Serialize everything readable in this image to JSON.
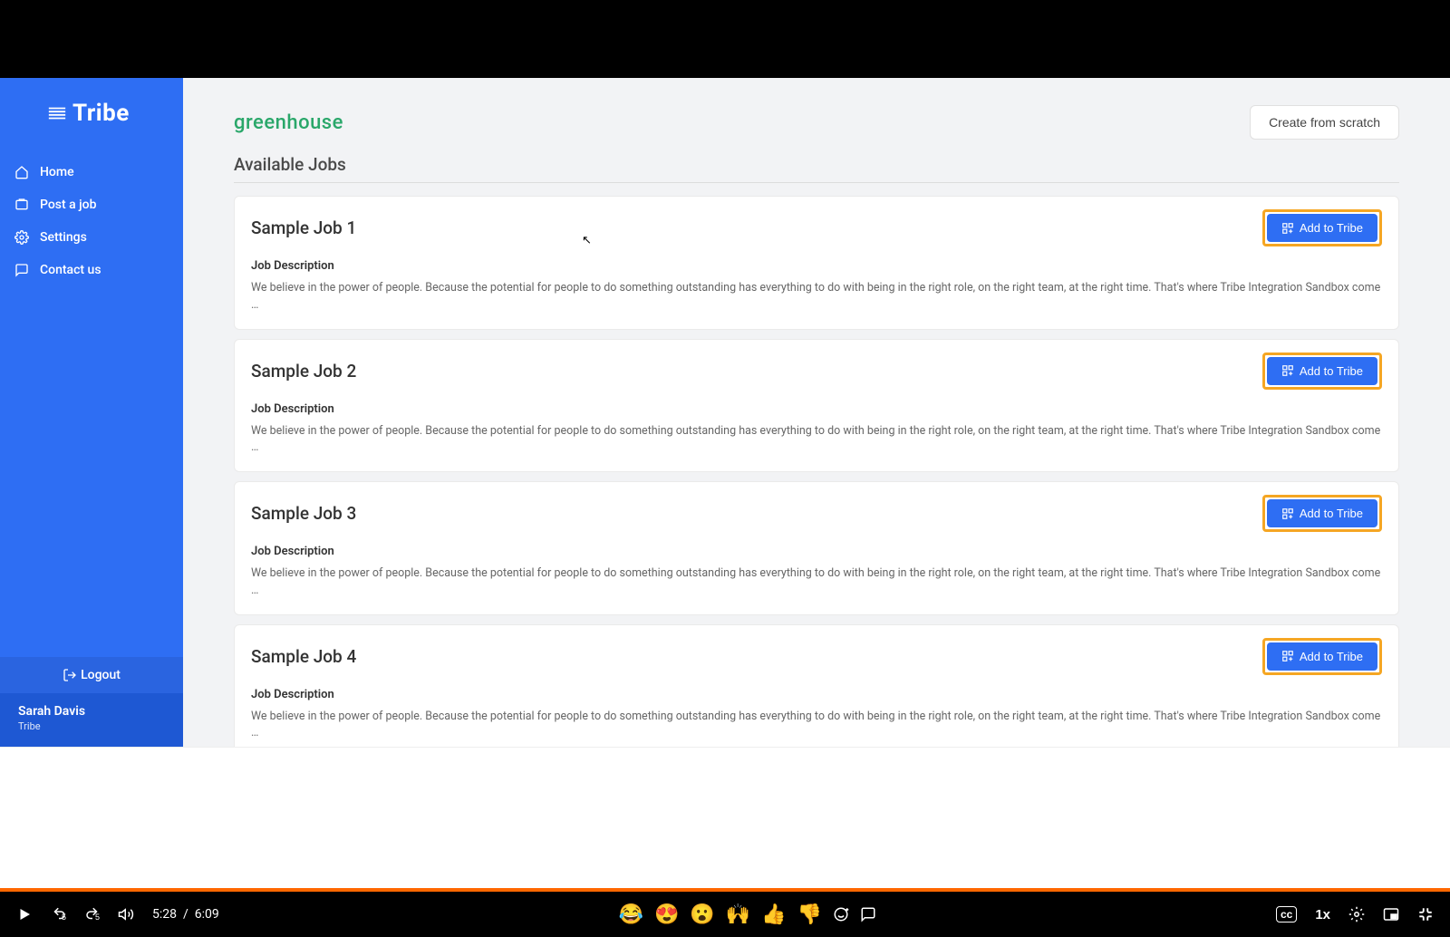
{
  "sidebar": {
    "logo_text": "Tribe",
    "nav": [
      {
        "label": "Home",
        "icon": "home-icon"
      },
      {
        "label": "Post a job",
        "icon": "post-job-icon"
      },
      {
        "label": "Settings",
        "icon": "settings-icon"
      },
      {
        "label": "Contact us",
        "icon": "contact-icon"
      }
    ],
    "logout_label": "Logout",
    "user_name": "Sarah Davis",
    "user_sub": "Tribe"
  },
  "content": {
    "brand": "greenhouse",
    "create_label": "Create from scratch",
    "section_title": "Available Jobs",
    "add_button_label": "Add to Tribe",
    "jobs": [
      {
        "title": "Sample Job 1",
        "sub": "Job Description",
        "desc": "We believe in the power of people. Because the potential for people to do something outstanding has everything to do with being in the right role, on the right team, at the right time. That's where Tribe Integration Sandbox come …"
      },
      {
        "title": "Sample Job 2",
        "sub": "Job Description",
        "desc": "We believe in the power of people. Because the potential for people to do something outstanding has everything to do with being in the right role, on the right team, at the right time. That's where Tribe Integration Sandbox come …"
      },
      {
        "title": "Sample Job 3",
        "sub": "Job Description",
        "desc": "We believe in the power of people. Because the potential for people to do something outstanding has everything to do with being in the right role, on the right team, at the right time. That's where Tribe Integration Sandbox come …"
      },
      {
        "title": "Sample Job 4",
        "sub": "Job Description",
        "desc": "We believe in the power of people. Because the potential for people to do something outstanding has everything to do with being in the right role, on the right team, at the right time. That's where Tribe Integration Sandbox come …"
      }
    ]
  },
  "video": {
    "current_time": "5:28",
    "duration": "6:09",
    "speed_label": "1x",
    "emojis": [
      "😂",
      "😍",
      "😮",
      "🙌",
      "👍",
      "👎"
    ],
    "cc_label": "cc"
  }
}
